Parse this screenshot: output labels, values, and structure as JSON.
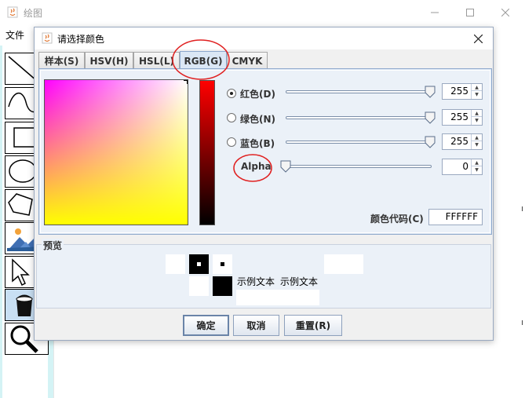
{
  "main_window": {
    "title": "绘图",
    "menu": [
      "文件"
    ],
    "tools": [
      "line-tool",
      "curve-tool",
      "rectangle-tool",
      "ellipse-tool",
      "polygon-tool",
      "image-tool",
      "select-tool",
      "fill-bucket-tool",
      "zoom-tool"
    ]
  },
  "dialog": {
    "title": "请选择颜色",
    "tabs": [
      {
        "label": "样本(S)",
        "active": false
      },
      {
        "label": "HSV(H)",
        "active": false
      },
      {
        "label": "HSL(L)",
        "active": false
      },
      {
        "label": "RGB(G)",
        "active": true
      },
      {
        "label": "CMYK",
        "active": false
      }
    ],
    "rgb": {
      "red_label": "红色(D)",
      "green_label": "绿色(N)",
      "blue_label": "蓝色(B)",
      "alpha_label": "Alpha",
      "red": 255,
      "green": 255,
      "blue": 255,
      "alpha": 0,
      "selected_channel": "red",
      "code_label": "颜色代码(C)",
      "code_value": "FFFFFF"
    },
    "preview": {
      "label": "预览",
      "sample_text_1": "示例文本",
      "sample_text_2": "示例文本"
    },
    "buttons": {
      "ok": "确定",
      "cancel": "取消",
      "reset": "重置(R)"
    }
  },
  "colors": {
    "accent": "#dbe7f5",
    "annotation": "#e02020"
  }
}
